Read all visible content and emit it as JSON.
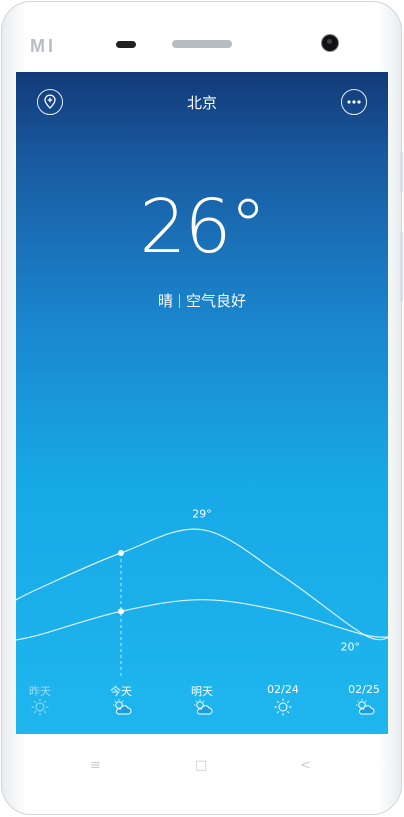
{
  "device": {
    "brand_logo": "MI"
  },
  "header": {
    "city": "北京",
    "add_city_icon": "location-plus-icon",
    "more_icon": "more-icon"
  },
  "current": {
    "temperature": "26°",
    "condition": "晴",
    "air_quality": "空气良好"
  },
  "chart_data": {
    "type": "line",
    "x": [
      "昨天",
      "今天",
      "明天",
      "02/24",
      "02/25"
    ],
    "series": [
      {
        "values": [
          24,
          27,
          29,
          25,
          20
        ]
      },
      {
        "values": [
          20,
          22,
          23,
          22,
          20
        ]
      }
    ],
    "annotations": [
      {
        "label": "29°",
        "series": 0,
        "index": 2
      },
      {
        "label": "20°",
        "series": 0,
        "index": 4
      }
    ],
    "highlight_index": 1,
    "grid": false
  },
  "forecast": [
    {
      "label": "昨天",
      "icon": "sun-icon",
      "past": true
    },
    {
      "label": "今天",
      "icon": "partly-cloudy-icon",
      "past": false
    },
    {
      "label": "明天",
      "icon": "partly-cloudy-icon",
      "past": false
    },
    {
      "label": "02/24",
      "icon": "sun-icon",
      "past": false
    },
    {
      "label": "02/25",
      "icon": "partly-cloudy-icon",
      "past": false
    }
  ],
  "softkeys": {
    "menu": "≡",
    "home": "□",
    "back": "<"
  },
  "colors": {
    "sky_top": "#123a78",
    "sky_bottom": "#1fb6ef",
    "text": "#ffffff"
  }
}
